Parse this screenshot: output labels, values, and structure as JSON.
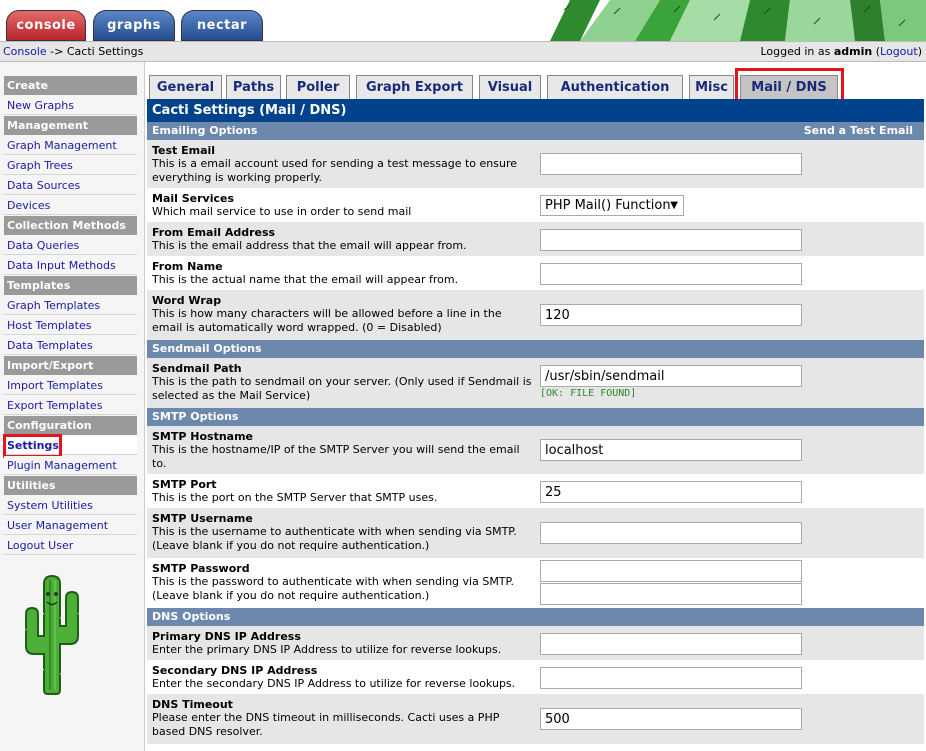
{
  "top_tabs": [
    "console",
    "graphs",
    "nectar"
  ],
  "breadcrumb": {
    "home": "Console",
    "sep": " -> ",
    "current": "Cacti Settings"
  },
  "login": {
    "prefix": "Logged in as ",
    "user": "admin",
    "logout_open": " (",
    "logout": "Logout",
    "logout_close": ")"
  },
  "sidebar": {
    "create_head": "Create",
    "new_graphs": "New Graphs",
    "management_head": "Management",
    "graph_management": "Graph Management",
    "graph_trees": "Graph Trees",
    "data_sources": "Data Sources",
    "devices": "Devices",
    "collection_head": "Collection Methods",
    "data_queries": "Data Queries",
    "data_input_methods": "Data Input Methods",
    "templates_head": "Templates",
    "graph_templates": "Graph Templates",
    "host_templates": "Host Templates",
    "data_templates": "Data Templates",
    "import_export_head": "Import/Export",
    "import_templates": "Import Templates",
    "export_templates": "Export Templates",
    "configuration_head": "Configuration",
    "settings": "Settings",
    "plugin_management": "Plugin Management",
    "utilities_head": "Utilities",
    "system_utilities": "System Utilities",
    "user_management": "User Management",
    "logout_user": "Logout User"
  },
  "tabs": {
    "general": "General",
    "paths": "Paths",
    "poller": "Poller",
    "graph_export": "Graph Export",
    "visual": "Visual",
    "authentication": "Authentication",
    "misc": "Misc",
    "mail_dns": "Mail / DNS"
  },
  "page_title": "Cacti Settings (Mail / DNS)",
  "sections": {
    "emailing": "Emailing Options",
    "send_test": "Send a Test Email",
    "sendmail": "Sendmail Options",
    "smtp": "SMTP Options",
    "dns": "DNS Options"
  },
  "settings": {
    "test_email": {
      "title": "Test Email",
      "desc": "This is a email account used for sending a test message to ensure everything is working properly.",
      "value": ""
    },
    "mail_services": {
      "title": "Mail Services",
      "desc": "Which mail service to use in order to send mail",
      "value": "PHP Mail() Function"
    },
    "from_email": {
      "title": "From Email Address",
      "desc": "This is the email address that the email will appear from.",
      "value": ""
    },
    "from_name": {
      "title": "From Name",
      "desc": "This is the actual name that the email will appear from.",
      "value": ""
    },
    "word_wrap": {
      "title": "Word Wrap",
      "desc": "This is how many characters will be allowed before a line in the email is automatically word wrapped. (0 = Disabled)",
      "value": "120"
    },
    "sendmail_path": {
      "title": "Sendmail Path",
      "desc": "This is the path to sendmail on your server. (Only used if Sendmail is selected as the Mail Service)",
      "value": "/usr/sbin/sendmail",
      "status": "[OK: FILE FOUND]"
    },
    "smtp_hostname": {
      "title": "SMTP Hostname",
      "desc": "This is the hostname/IP of the SMTP Server you will send the email to.",
      "value": "localhost"
    },
    "smtp_port": {
      "title": "SMTP Port",
      "desc": "This is the port on the SMTP Server that SMTP uses.",
      "value": "25"
    },
    "smtp_username": {
      "title": "SMTP Username",
      "desc": "This is the username to authenticate with when sending via SMTP. (Leave blank if you do not require authentication.)",
      "value": ""
    },
    "smtp_password": {
      "title": "SMTP Password",
      "desc": "This is the password to authenticate with when sending via SMTP. (Leave blank if you do not require authentication.)",
      "value": "",
      "confirm": ""
    },
    "primary_dns": {
      "title": "Primary DNS IP Address",
      "desc": "Enter the primary DNS IP Address to utilize for reverse lookups.",
      "value": ""
    },
    "secondary_dns": {
      "title": "Secondary DNS IP Address",
      "desc": "Enter the secondary DNS IP Address to utilize for reverse lookups.",
      "value": ""
    },
    "dns_timeout": {
      "title": "DNS Timeout",
      "desc": "Please enter the DNS timeout in milliseconds. Cacti uses a PHP based DNS resolver.",
      "value": "500"
    }
  },
  "colors": {
    "accent": "#00438c",
    "section": "#6d88ad",
    "highlight": "#e3141e"
  }
}
